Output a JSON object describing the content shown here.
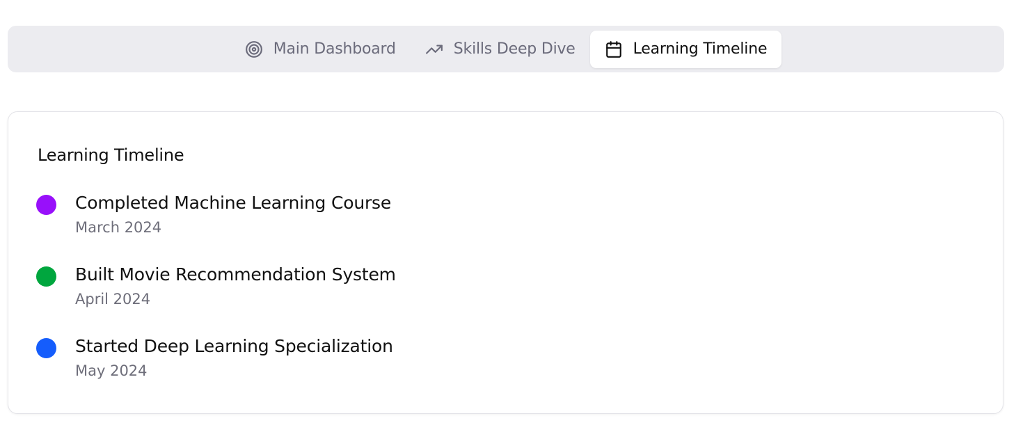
{
  "tabs": [
    {
      "label": "Main Dashboard",
      "icon": "target-icon",
      "active": false
    },
    {
      "label": "Skills Deep Dive",
      "icon": "trending-up-icon",
      "active": false
    },
    {
      "label": "Learning Timeline",
      "icon": "calendar-icon",
      "active": true
    }
  ],
  "card": {
    "title": "Learning Timeline",
    "events": [
      {
        "title": "Completed Machine Learning Course",
        "date": "March 2024",
        "color": "#9810fa"
      },
      {
        "title": "Built Movie Recommendation System",
        "date": "April 2024",
        "color": "#00a63e"
      },
      {
        "title": "Started Deep Learning Specialization",
        "date": "May 2024",
        "color": "#155dfc"
      }
    ]
  },
  "colors": {
    "tabbar_bg": "#ececf0",
    "inactive_text": "#6b6b7b",
    "muted_text": "#6e6e7a"
  }
}
